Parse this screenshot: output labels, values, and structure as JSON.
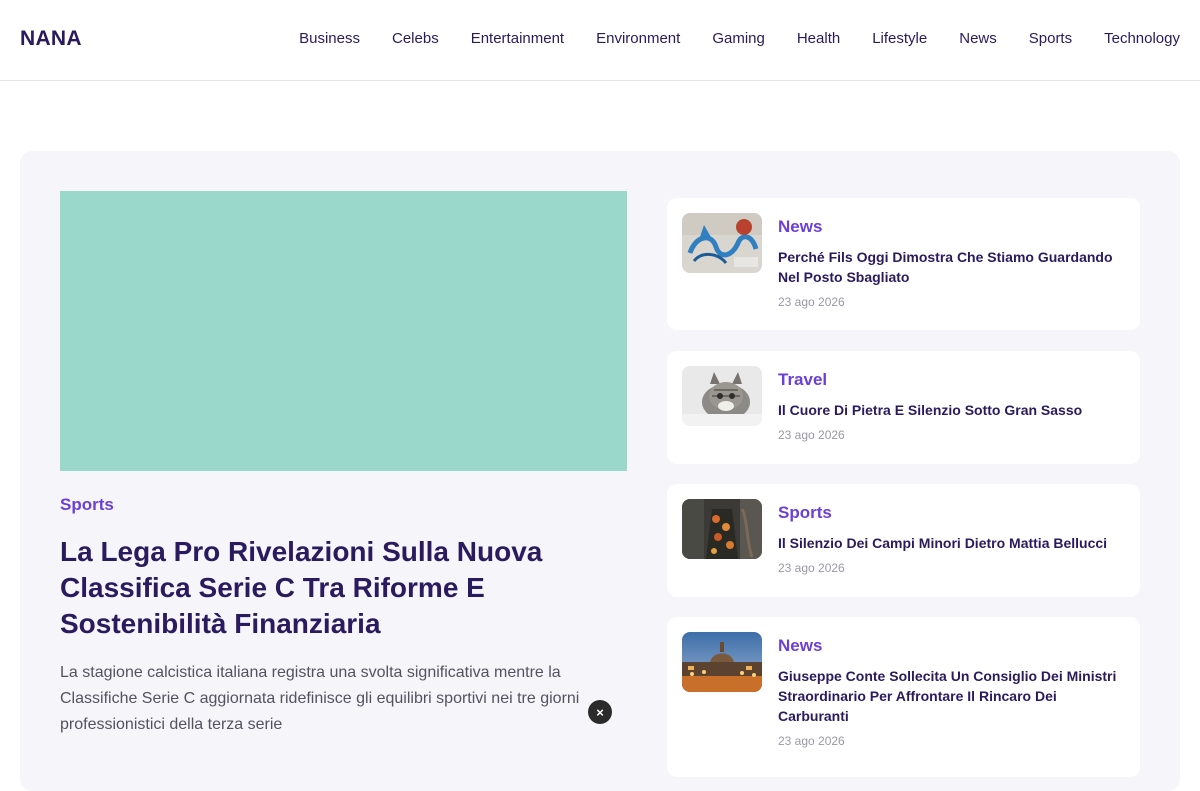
{
  "header": {
    "logo": "NANA",
    "nav": [
      "Business",
      "Celebs",
      "Entertainment",
      "Environment",
      "Gaming",
      "Health",
      "Lifestyle",
      "News",
      "Sports",
      "Technology"
    ]
  },
  "hero": {
    "image_color": "#9bd8cc",
    "category": "Sports",
    "title": "La Lega Pro Rivelazioni Sulla Nuova Classifica Serie C Tra Riforme E Sostenibilità Finanziaria",
    "excerpt": "La stagione calcistica italiana registra una svolta significativa mentre la Classifiche Serie C aggiornata ridefinisce gli equilibri sportivi nei tre giorni professionistici della terza serie"
  },
  "close_icon": "×",
  "sidebar": {
    "cards": [
      {
        "category": "News",
        "title": "Perché Fils Oggi Dimostra Che Stiamo Guardando Nel Posto Sbagliato",
        "date": "23 ago 2026",
        "thumb": "graffiti-wall"
      },
      {
        "category": "Travel",
        "title": "Il Cuore Di Pietra E Silenzio Sotto Gran Sasso",
        "date": "23 ago 2026",
        "thumb": "tabby-cat"
      },
      {
        "category": "Sports",
        "title": "Il Silenzio Dei Campi Minori Dietro Mattia Bellucci",
        "date": "23 ago 2026",
        "thumb": "floral-dress-person"
      },
      {
        "category": "News",
        "title": "Giuseppe Conte Sollecita Un Consiglio Dei Ministri Straordinario Per Affrontare Il Rincaro Dei Carburanti",
        "date": "23 ago 2026",
        "thumb": "city-night-dome"
      }
    ]
  },
  "colors": {
    "brand_text": "#2a1a5e",
    "accent_purple": "#6c3fd6",
    "panel_bg": "#f6f5f9"
  }
}
